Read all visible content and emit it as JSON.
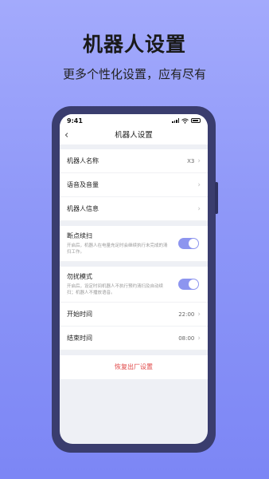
{
  "promo": {
    "title": "机器人设置",
    "subtitle": "更多个性化设置，应有尽有"
  },
  "status_bar": {
    "time": "9:41"
  },
  "nav": {
    "back_icon": "‹",
    "title": "机器人设置"
  },
  "section1": [
    {
      "label": "机器人名称",
      "value": "X3"
    },
    {
      "label": "语音及音量",
      "value": ""
    },
    {
      "label": "机器人信息",
      "value": ""
    }
  ],
  "breakpoint": {
    "title": "断点续扫",
    "desc": "开启后，机器人在电量充足时会继续执行未完成的清扫工作。",
    "enabled": true
  },
  "dnd": {
    "title": "勿扰模式",
    "desc": "开启后，设定时间机器人不执行预约清扫及自动续扫；机器人不播放语音。",
    "enabled": true
  },
  "schedule": [
    {
      "label": "开始时间",
      "value": "22:00"
    },
    {
      "label": "结束时间",
      "value": "08:00"
    }
  ],
  "reset_label": "恢复出厂设置",
  "chevron": "›",
  "colors": {
    "accent": "#8d95ef",
    "danger": "#e04646",
    "bg_top": "#a3aafc",
    "bg_bottom": "#7c86f5"
  }
}
